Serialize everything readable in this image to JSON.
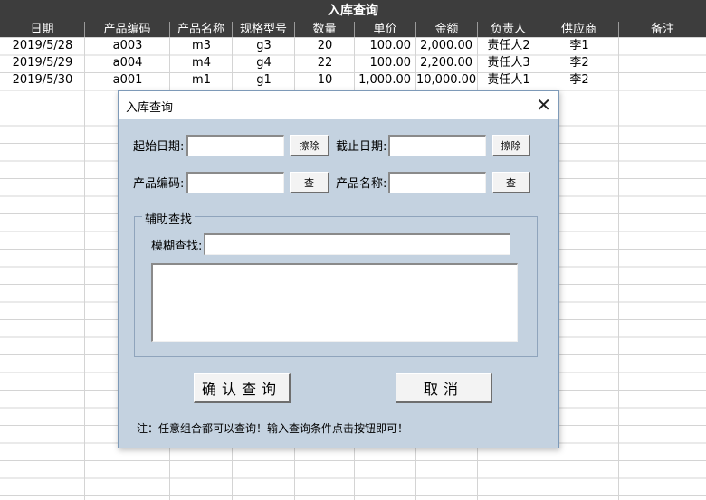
{
  "sheet": {
    "title": "入库查询",
    "columns": [
      "日期",
      "产品编码",
      "产品名称",
      "规格型号",
      "数量",
      "单价",
      "金额",
      "负责人",
      "供应商",
      "备注"
    ],
    "rows": [
      [
        "2019/5/28",
        "a003",
        "m3",
        "g3",
        "20",
        "100.00",
        "2,000.00",
        "责任人2",
        "李1",
        ""
      ],
      [
        "2019/5/29",
        "a004",
        "m4",
        "g4",
        "22",
        "100.00",
        "2,200.00",
        "责任人3",
        "李2",
        ""
      ],
      [
        "2019/5/30",
        "a001",
        "m1",
        "g1",
        "10",
        "1,000.00",
        "10,000.00",
        "责任人1",
        "李2",
        ""
      ]
    ]
  },
  "dialog": {
    "title": "入库查询",
    "close_glyph": "✕",
    "start_date_label": "起始日期:",
    "start_date_value": "",
    "clear_label": "擦除",
    "end_date_label": "截止日期:",
    "end_date_value": "",
    "code_label": "产品编码:",
    "code_value": "",
    "check_label": "查",
    "name_label": "产品名称:",
    "name_value": "",
    "group_title": "辅助查找",
    "fuzzy_label": "模糊查找:",
    "fuzzy_value": "",
    "confirm_label": "确认查询",
    "cancel_label": "取消",
    "note": "注：任意组合都可以查询！输入查询条件点击按钮即可！"
  }
}
